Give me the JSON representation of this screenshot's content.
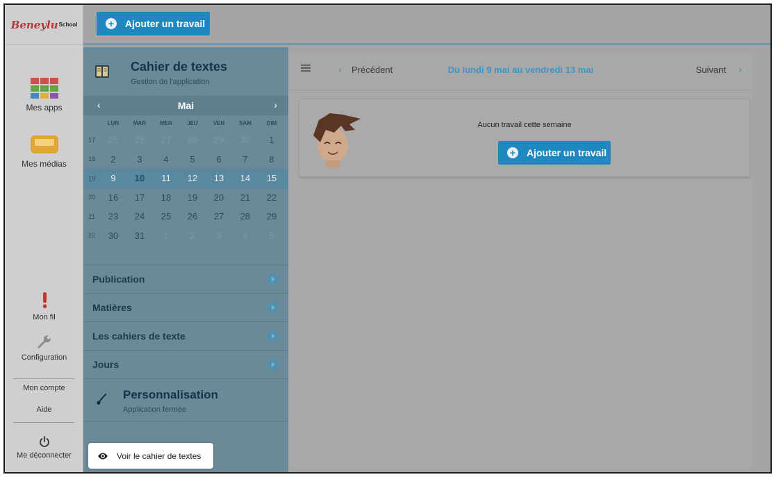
{
  "logo": {
    "text": "Beneylu",
    "sub": "School"
  },
  "appbar": {
    "apps_label": "Mes apps",
    "medias_label": "Mes médias",
    "fil_label": "Mon fil",
    "config_label": "Configuration",
    "account_label": "Mon compte",
    "help_label": "Aide",
    "logout_label": "Me déconnecter"
  },
  "header": {
    "add_button_label": "Ajouter un travail"
  },
  "panel": {
    "title": "Cahier de textes",
    "subtitle": "Gestion de l'application",
    "calendar": {
      "month": "Mai",
      "prev_icon": "chevron-left-icon",
      "next_icon": "chevron-right-icon",
      "weekdays": [
        "LUN",
        "MAR",
        "MER",
        "JEU",
        "VEN",
        "SAM",
        "DIM"
      ],
      "weeks": [
        {
          "num": "17",
          "days": [
            "25",
            "26",
            "27",
            "28",
            "29",
            "30",
            "1"
          ]
        },
        {
          "num": "18",
          "days": [
            "2",
            "3",
            "4",
            "5",
            "6",
            "7",
            "8"
          ]
        },
        {
          "num": "19",
          "days": [
            "9",
            "10",
            "11",
            "12",
            "13",
            "14",
            "15"
          ]
        },
        {
          "num": "20",
          "days": [
            "16",
            "17",
            "18",
            "19",
            "20",
            "21",
            "22"
          ]
        },
        {
          "num": "21",
          "days": [
            "23",
            "24",
            "25",
            "26",
            "27",
            "28",
            "29"
          ]
        },
        {
          "num": "22",
          "days": [
            "30",
            "31",
            "1",
            "2",
            "3",
            "4",
            "5"
          ]
        }
      ],
      "selected_week": "19",
      "today": "10"
    },
    "sections": [
      "Publication",
      "Matières",
      "Les cahiers de texte",
      "Jours"
    ],
    "personnalisation": {
      "title": "Personnalisation",
      "subtitle": "Application fermée"
    },
    "voir_label": "Voir le cahier de textes"
  },
  "main": {
    "prev_label": "Précédent",
    "week_title": "Du lundi 9 mai au vendredi 13 mai",
    "next_label": "Suivant",
    "empty_text": "Aucun travail cette semaine",
    "add_button_label": "Ajouter un travail"
  },
  "colors": {
    "accent": "#1e88c0",
    "week_title": "#3b95c4"
  }
}
